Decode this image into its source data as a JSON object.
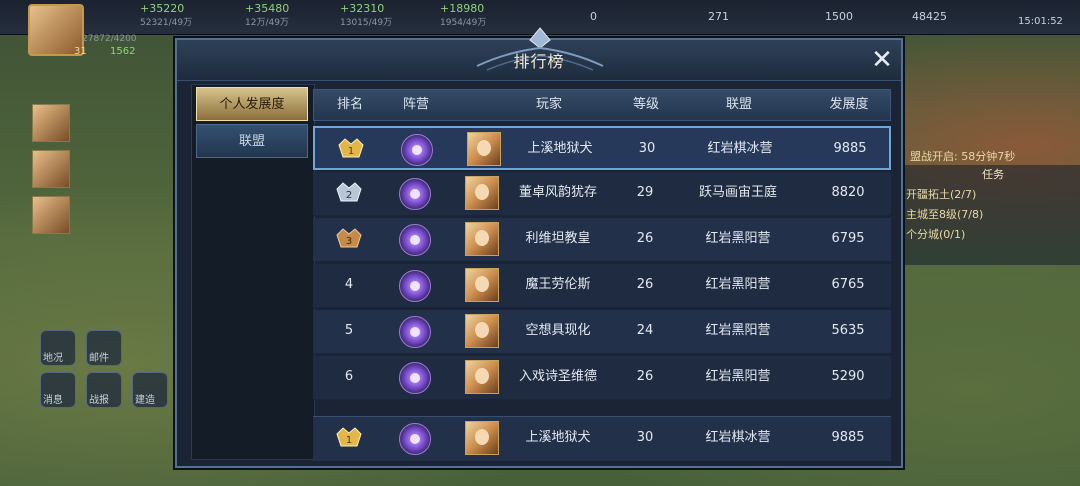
{
  "topbar": {
    "resources": [
      {
        "plus": "+35220",
        "sub": "52321/49万"
      },
      {
        "plus": "+35480",
        "sub": "12万/49万"
      },
      {
        "plus": "+32310",
        "sub": "13015/49万"
      },
      {
        "plus": "+18980",
        "sub": "1954/49万"
      },
      {
        "value": "0"
      },
      {
        "value": "271"
      },
      {
        "value": "1500"
      },
      {
        "value": "48425"
      }
    ],
    "time": "15:01:52",
    "player_power": "27872/4200",
    "player_level": "31",
    "player_points": "1562"
  },
  "background": {
    "quest_title": "任务",
    "quests": [
      "开疆拓土(2/7)",
      "主城至8级(7/8)",
      "个分城(0/1)"
    ],
    "countdown": "盟战开启: 58分钟7秒",
    "bottom_buttons": [
      "地况",
      "邮件",
      "消息",
      "战报",
      "建造"
    ]
  },
  "dialog": {
    "title": "排行榜",
    "close_icon": "close-icon",
    "tabs": {
      "personal": "个人发展度",
      "alliance": "联盟"
    },
    "columns": {
      "rank": "排名",
      "camp": "阵营",
      "player": "玩家",
      "level": "等级",
      "alliance": "联盟",
      "development": "发展度"
    },
    "rows": [
      {
        "rank": "1",
        "medal": "gold",
        "player": "上溪地狱犬",
        "level": "30",
        "alliance": "红岩棋冰营",
        "development": "9885"
      },
      {
        "rank": "2",
        "medal": "silver",
        "player": "董卓风韵犹存",
        "level": "29",
        "alliance": "跃马画宙王庭",
        "development": "8820"
      },
      {
        "rank": "3",
        "medal": "bronze",
        "player": "利维坦教皇",
        "level": "26",
        "alliance": "红岩黑阳营",
        "development": "6795"
      },
      {
        "rank": "4",
        "medal": "",
        "player": "魔王劳伦斯",
        "level": "26",
        "alliance": "红岩黑阳营",
        "development": "6765"
      },
      {
        "rank": "5",
        "medal": "",
        "player": "空想具现化",
        "level": "24",
        "alliance": "红岩黑阳营",
        "development": "5635"
      },
      {
        "rank": "6",
        "medal": "",
        "player": "入戏诗圣维德",
        "level": "26",
        "alliance": "红岩黑阳营",
        "development": "5290"
      }
    ],
    "my_rank": {
      "rank": "1",
      "medal": "gold",
      "player": "上溪地狱犬",
      "level": "30",
      "alliance": "红岩棋冰营",
      "development": "9885"
    }
  }
}
